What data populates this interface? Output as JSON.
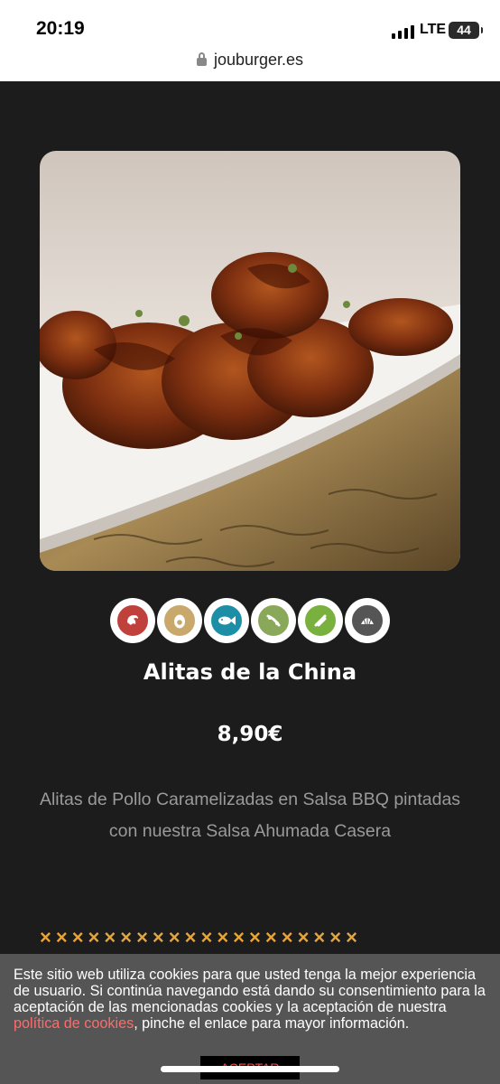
{
  "status_bar": {
    "time": "20:19",
    "network": "LTE",
    "battery": "44",
    "url": "jouburger.es"
  },
  "dish": {
    "name": "Alitas de la China",
    "price": "8,90€",
    "description": "Alitas de Pollo Caramelizadas en Salsa BBQ pintadas con nuestra Salsa Ahumada Casera"
  },
  "allergens": [
    {
      "icon": "shellfish-icon",
      "color": "#c0413b"
    },
    {
      "icon": "egg-icon",
      "color": "#c9a86b"
    },
    {
      "icon": "fish-icon",
      "color": "#1c8fa7"
    },
    {
      "icon": "soy-icon",
      "color": "#8aa85a"
    },
    {
      "icon": "celery-icon",
      "color": "#7ab13e"
    },
    {
      "icon": "mollusc-icon",
      "color": "#555555"
    }
  ],
  "divider": "××××××××××××××××××××",
  "cookie_banner": {
    "text_before": "Este sitio web utiliza cookies para que usted tenga la mejor experiencia de usuario. Si continúa navegando está dando su consentimiento para la aceptación de las mencionadas cookies y la aceptación de nuestra ",
    "link_text": "política de cookies",
    "text_after": ", pinche el enlace para mayor información.",
    "accept_label": "ACEPTAR"
  }
}
